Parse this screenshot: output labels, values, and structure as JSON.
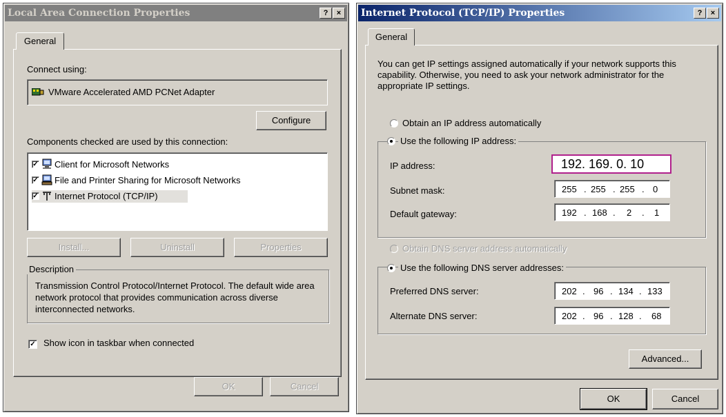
{
  "left_window": {
    "title": "Local Area Connection Properties",
    "help_glyph": "?",
    "close_glyph": "×",
    "tab": "General",
    "connect_using_label": "Connect using:",
    "adapter_name": "VMware Accelerated AMD PCNet Adapter",
    "configure_label": "Configure",
    "components_label": "Components checked are used by this connection:",
    "components": [
      {
        "label": "Client for Microsoft Networks",
        "checked": true,
        "icon": "network-client-icon"
      },
      {
        "label": "File and Printer Sharing for Microsoft Networks",
        "checked": true,
        "icon": "file-printer-sharing-icon"
      },
      {
        "label": "Internet Protocol (TCP/IP)",
        "checked": true,
        "icon": "protocol-icon"
      }
    ],
    "install_label": "Install...",
    "uninstall_label": "Uninstall",
    "properties_label": "Properties",
    "description_legend": "Description",
    "description_text": "Transmission Control Protocol/Internet Protocol. The default wide area network protocol that provides communication across diverse interconnected networks.",
    "show_icon_label": "Show icon in taskbar when connected",
    "show_icon_checked": true,
    "ok_label": "OK",
    "cancel_label": "Cancel"
  },
  "right_window": {
    "title": "Internet Protocol (TCP/IP) Properties",
    "help_glyph": "?",
    "close_glyph": "×",
    "tab": "General",
    "intro_text": "You can get IP settings assigned automatically if your network supports this capability. Otherwise, you need to ask your network administrator for the appropriate IP settings.",
    "obtain_ip_auto": "Obtain an IP address automatically",
    "use_following_ip": "Use the following IP address:",
    "ip_address_label": "IP address:",
    "ip_address_value": "192. 169. 0. 10",
    "subnet_mask_label": "Subnet mask:",
    "subnet_mask_value": [
      "255",
      "255",
      "255",
      "0"
    ],
    "gateway_label": "Default gateway:",
    "gateway_value": [
      "192",
      "168",
      "2",
      "1"
    ],
    "obtain_dns_auto": "Obtain DNS server address automatically",
    "use_following_dns": "Use the following DNS server addresses:",
    "preferred_dns_label": "Preferred DNS server:",
    "preferred_dns_value": [
      "202",
      "96",
      "134",
      "133"
    ],
    "alternate_dns_label": "Alternate DNS server:",
    "alternate_dns_value": [
      "202",
      "96",
      "128",
      "68"
    ],
    "advanced_label": "Advanced...",
    "ok_label": "OK",
    "cancel_label": "Cancel",
    "ip_highlight_color": "#b0208c"
  }
}
